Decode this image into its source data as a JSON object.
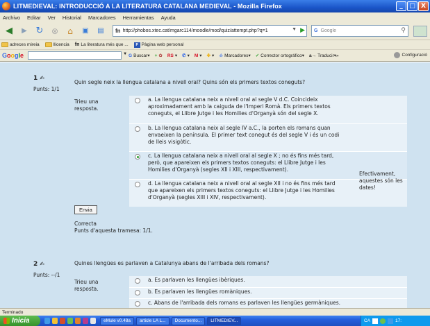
{
  "window": {
    "title": "LITMEDIEVAL: INTRODUCCIÓ A LA LITERATURA CATALANA MEDIEVAL - Mozilla Firefox",
    "buttons": [
      "_",
      "□",
      "X"
    ]
  },
  "menu": [
    "Archivo",
    "Editar",
    "Ver",
    "Historial",
    "Marcadores",
    "Herramientas",
    "Ayuda"
  ],
  "navigation": {
    "url": "http://phobos.xtec.cat/mgarc114/moodle/mod/quiz/attempt.php?q=1",
    "url_favicon": "fn",
    "search_placeholder": "Google",
    "search_engine": "G"
  },
  "bookmarks": [
    {
      "label": "adreces mireia",
      "icon": "folder-icon"
    },
    {
      "label": "llicencia",
      "icon": "folder-icon"
    },
    {
      "label": "La literatura més que ...",
      "icon": "moodle-icon"
    },
    {
      "label": "Pàgina web personal",
      "icon": "page-icon"
    }
  ],
  "google_toolbar": {
    "logo": "Google",
    "buscar": "Buscar",
    "rs": "RS",
    "marcadores": "Marcadores",
    "corrector": "Corrector ortográfico",
    "traducir": "Traducir",
    "more": "»",
    "configuracion": "Configuració"
  },
  "quiz": {
    "q1": {
      "number": "1",
      "marks": "Punts: 1/1",
      "text": "Quin segle neix la llengua catalana a nivell oral? Quins són els primers textos coneguts?",
      "prompt": "Trieu una resposta.",
      "options": [
        "a. La llengua catalana neix a nivell oral al segle V d.C. Coincideix aproximadament amb la caiguda de l'Imperi Romà. Els primers textos coneguts, el Llibre Jutge i les Homilies d'Organyà són del segle X.",
        "b. La llengua catalana neix al segle IV a.C., la porten els romans quan envaeixen la península. El primer text conegut és del segle V i és un codi de lleis visigòtic.",
        "c. La llengua catalana neix a nivell oral al segle X ; no és fins més tard, però, que apareixen els primers textos coneguts: el Llibre Jutge i les Homilies d'Organyà (segles XII i XIII, respectivament).",
        "d. La llengua catalana neix a nivell oral al segle XII i no és fins més tard que apareixen els primers textos coneguts: el Llibre Jutge i les Homilies d'Organyà (segles XIII i XIV, respectivament)."
      ],
      "selected_index": 2,
      "feedback": "Efectivament, aquestes són les dates!",
      "submit_label": "Envia",
      "result_label": "Correcta",
      "result_marks": "Punts d'aquesta tramesa: 1/1."
    },
    "q2": {
      "number": "2",
      "marks": "Punts: --/1",
      "text": "Quines llengües es parlaven a Catalunya abans de l'arribada dels romans?",
      "prompt": "Trieu una resposta.",
      "options": [
        "a. Es parlaven les llengües ibèriques.",
        "b. Es parlaven les llengües romàniques.",
        "c. Abans de l'arribada dels romans es parlaven les llengües germàniques."
      ]
    }
  },
  "status": "Terminado",
  "taskbar": {
    "start": "Inicia",
    "tasks": [
      "eMule v0.48a",
      "article LA L...",
      "Documento...",
      "LITMEDIEV...",
      "CA"
    ],
    "clock": "17:"
  },
  "colors": {
    "content_bg": "#cfe2f0",
    "answer_bg": "#e8f1f8",
    "titlebar": "#1b56c9",
    "radio_selected": "#27a02b"
  }
}
